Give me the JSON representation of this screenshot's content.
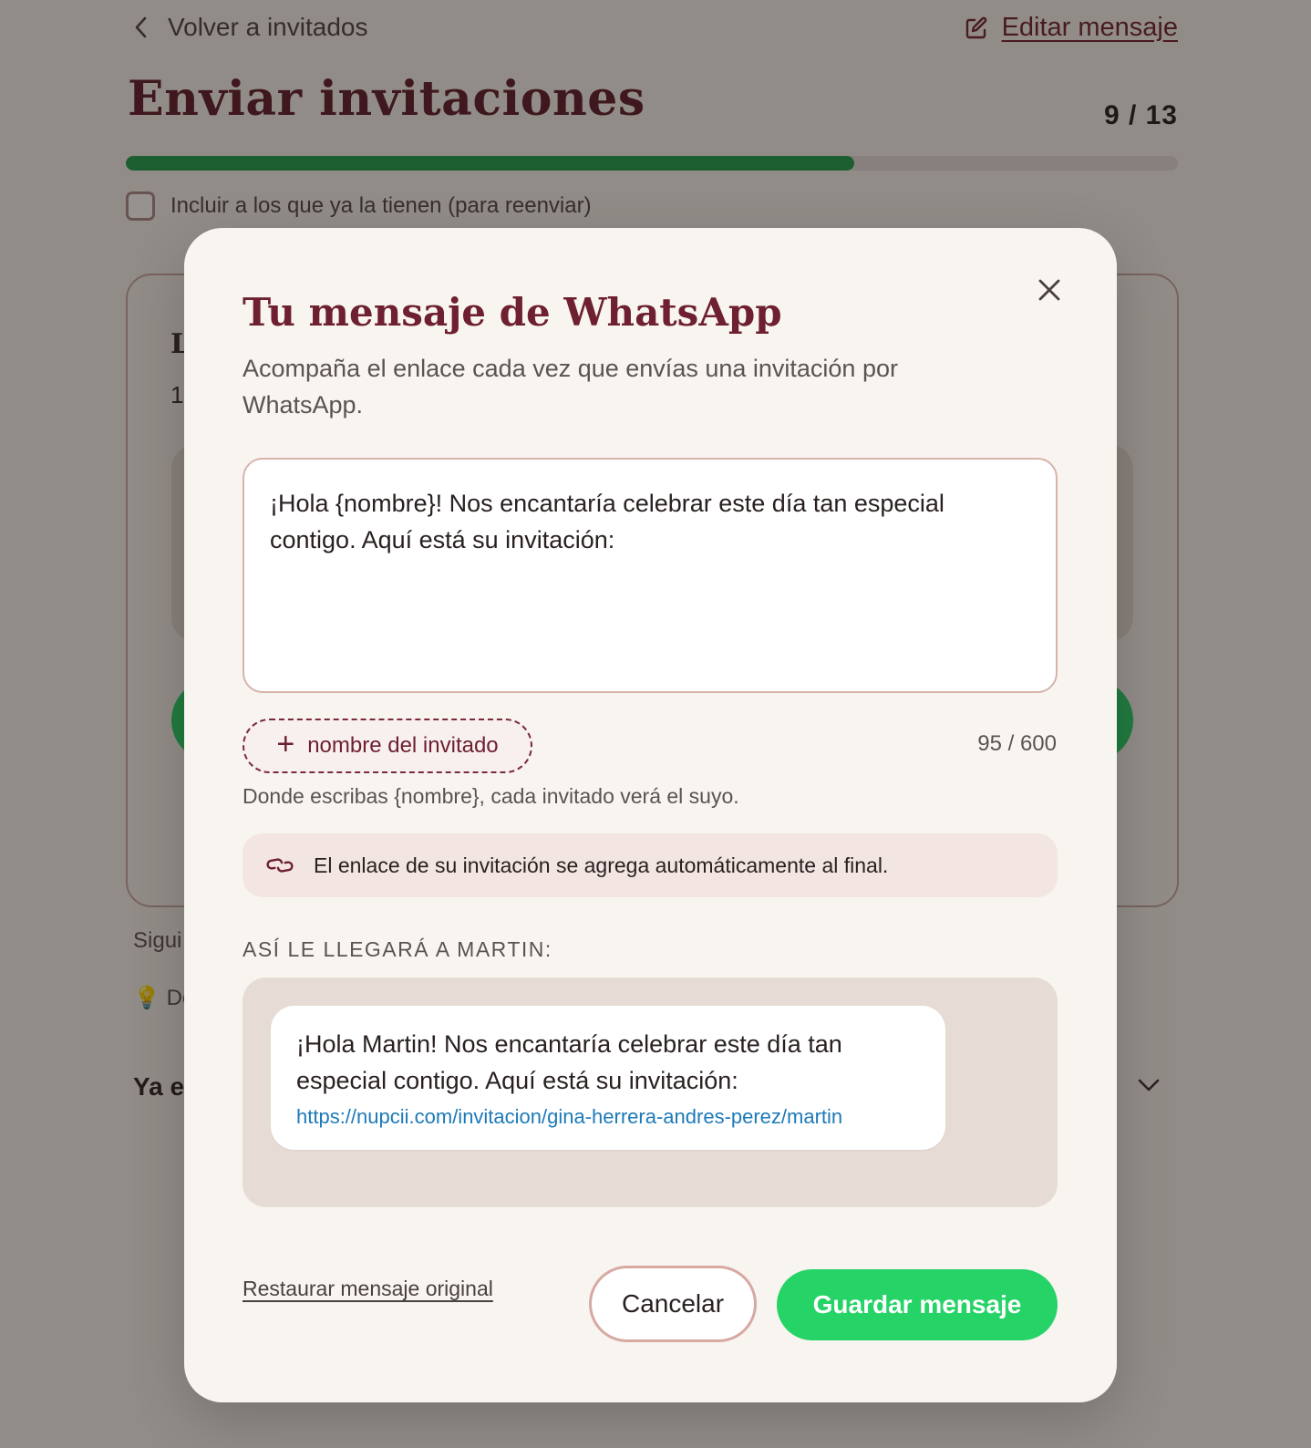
{
  "background": {
    "back_link": "Volver a invitados",
    "edit_link": "Editar mensaje",
    "page_title": "Enviar invitaciones",
    "counter": "9 / 13",
    "progress": {
      "sent": 9,
      "total": 13,
      "color": "#1e9e4a"
    },
    "include_checkbox_label": "Incluir a los que ya la tienen (para reenviar)",
    "partial_texts": {
      "card_letter": "L",
      "card_digit": "1",
      "next": "Sigui",
      "tip": "De",
      "already": "Ya e"
    }
  },
  "modal": {
    "title": "Tu mensaje de WhatsApp",
    "subtitle": "Acompaña el enlace cada vez que envías una invitación por WhatsApp.",
    "message_value": "¡Hola {nombre}! Nos encantaría celebrar este día tan especial contigo. Aquí está su invitación:",
    "insert_name_button": "nombre del invitado",
    "char_count": "95 / 600",
    "hint": "Donde escribas {nombre}, cada invitado verá el suyo.",
    "link_note": "El enlace de su invitación se agrega automáticamente al final.",
    "preview_label": "ASÍ LE LLEGARÁ A MARTIN:",
    "preview_message": "¡Hola Martin! Nos encantaría celebrar este día tan especial contigo. Aquí está su invitación:",
    "preview_link": "https://nupcii.com/invitacion/gina-herrera-andres-perez/martin",
    "restore_link": "Restaurar mensaje original",
    "cancel_button": "Cancelar",
    "save_button": "Guardar mensaje"
  },
  "icons": {
    "back": "chevron-left-icon",
    "edit": "edit-icon",
    "close": "close-icon",
    "add": "plus-icon",
    "link": "link-icon",
    "expand": "chevron-down-icon"
  },
  "colors": {
    "brand": "#6e1f30",
    "whatsapp_green": "#25d366",
    "link": "#1d7ab8"
  }
}
